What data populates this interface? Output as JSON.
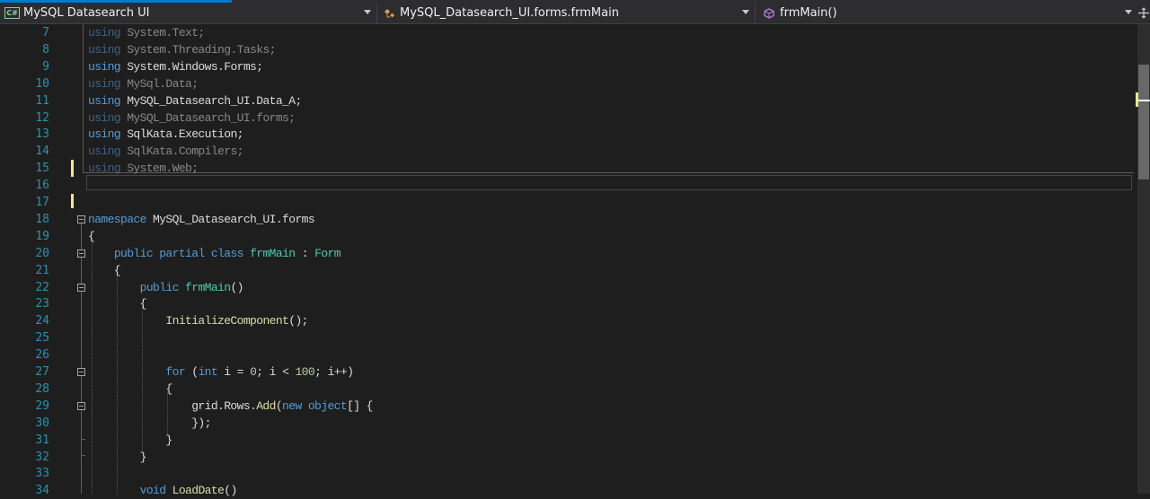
{
  "navbar": {
    "project": "MySQL Datasearch UI",
    "type_scope": "MySQL_Datasearch_UI.forms.frmMain",
    "member": "frmMain()"
  },
  "editor": {
    "lines": [
      {
        "n": "7",
        "tokens": [
          {
            "t": "using ",
            "c": "kw"
          },
          {
            "t": "System.Text;"
          }
        ],
        "dim": true
      },
      {
        "n": "8",
        "tokens": [
          {
            "t": "using ",
            "c": "kw"
          },
          {
            "t": "System.Threading.Tasks;"
          }
        ],
        "dim": true
      },
      {
        "n": "9",
        "tokens": [
          {
            "t": "using ",
            "c": "kw"
          },
          {
            "t": "System.Windows.Forms;"
          }
        ]
      },
      {
        "n": "10",
        "tokens": [
          {
            "t": "using ",
            "c": "kw"
          },
          {
            "t": "MySql.Data;"
          }
        ],
        "dim": true
      },
      {
        "n": "11",
        "tokens": [
          {
            "t": "using ",
            "c": "kw"
          },
          {
            "t": "MySQL_Datasearch_UI.Data_A;"
          }
        ]
      },
      {
        "n": "12",
        "tokens": [
          {
            "t": "using ",
            "c": "kw"
          },
          {
            "t": "MySQL_Datasearch_UI.forms;"
          }
        ],
        "dim": true
      },
      {
        "n": "13",
        "tokens": [
          {
            "t": "using ",
            "c": "kw"
          },
          {
            "t": "SqlKata.Execution;"
          }
        ]
      },
      {
        "n": "14",
        "tokens": [
          {
            "t": "using ",
            "c": "kw"
          },
          {
            "t": "SqlKata.Compilers;"
          }
        ],
        "dim": true
      },
      {
        "n": "15",
        "tokens": [
          {
            "t": "using ",
            "c": "kw"
          },
          {
            "t": "System.Web;"
          }
        ],
        "dim": true
      },
      {
        "n": "16",
        "tokens": []
      },
      {
        "n": "17",
        "tokens": []
      },
      {
        "n": "18",
        "tokens": [
          {
            "t": "namespace ",
            "c": "kw"
          },
          {
            "t": "MySQL_Datasearch_UI.forms"
          }
        ]
      },
      {
        "n": "19",
        "tokens": [
          {
            "t": "{"
          }
        ]
      },
      {
        "n": "20",
        "tokens": [
          {
            "t": "    "
          },
          {
            "t": "public ",
            "c": "kw"
          },
          {
            "t": "partial ",
            "c": "kw"
          },
          {
            "t": "class ",
            "c": "kw"
          },
          {
            "t": "frmMain",
            "c": "ty"
          },
          {
            "t": " : "
          },
          {
            "t": "Form",
            "c": "ty"
          }
        ]
      },
      {
        "n": "21",
        "tokens": [
          {
            "t": "    {"
          }
        ]
      },
      {
        "n": "22",
        "tokens": [
          {
            "t": "        "
          },
          {
            "t": "public ",
            "c": "kw"
          },
          {
            "t": "frmMain",
            "c": "ty"
          },
          {
            "t": "()"
          }
        ]
      },
      {
        "n": "23",
        "tokens": [
          {
            "t": "        {"
          }
        ]
      },
      {
        "n": "24",
        "tokens": [
          {
            "t": "            "
          },
          {
            "t": "InitializeComponent",
            "c": "fn"
          },
          {
            "t": "();"
          }
        ]
      },
      {
        "n": "25",
        "tokens": []
      },
      {
        "n": "26",
        "tokens": []
      },
      {
        "n": "27",
        "tokens": [
          {
            "t": "            "
          },
          {
            "t": "for ",
            "c": "kw"
          },
          {
            "t": "("
          },
          {
            "t": "int ",
            "c": "kw"
          },
          {
            "t": "i = "
          },
          {
            "t": "0",
            "c": "nm"
          },
          {
            "t": "; i < "
          },
          {
            "t": "100",
            "c": "nm"
          },
          {
            "t": "; i++)"
          }
        ]
      },
      {
        "n": "28",
        "tokens": [
          {
            "t": "            {"
          }
        ]
      },
      {
        "n": "29",
        "tokens": [
          {
            "t": "                grid.Rows."
          },
          {
            "t": "Add",
            "c": "fn"
          },
          {
            "t": "("
          },
          {
            "t": "new ",
            "c": "kw"
          },
          {
            "t": "object",
            "c": "kw"
          },
          {
            "t": "[] {"
          }
        ]
      },
      {
        "n": "30",
        "tokens": [
          {
            "t": "                });"
          }
        ]
      },
      {
        "n": "31",
        "tokens": [
          {
            "t": "            }"
          }
        ]
      },
      {
        "n": "32",
        "tokens": [
          {
            "t": "        }"
          }
        ]
      },
      {
        "n": "33",
        "tokens": []
      },
      {
        "n": "34",
        "tokens": [
          {
            "t": "        "
          },
          {
            "t": "void ",
            "c": "kw"
          },
          {
            "t": "LoadDate",
            "c": "fn"
          },
          {
            "t": "()"
          }
        ]
      }
    ]
  }
}
